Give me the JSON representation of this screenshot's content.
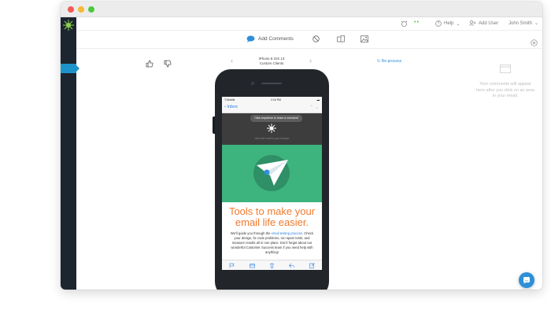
{
  "topbar": {
    "help_label": "Help",
    "add_user_label": "Add User",
    "user_name": "John Smith"
  },
  "toolbar": {
    "add_comments_label": "Add Comments"
  },
  "preview": {
    "device_line1": "iPhone 8 iOS 13",
    "device_line2": "Custom Clients",
    "reprocess_label": "Re-process"
  },
  "comments": {
    "empty_text": "Your comments will appear here after you click on an area in your email."
  },
  "email": {
    "carrier": "T-Mobile",
    "time": "2:16 PM",
    "back_label": "Inbox",
    "tooltip": "Click anywhere to leave a comment",
    "view_in_browser": "View this email in your browser",
    "headline": "Tools to make your email life easier.",
    "body_before_link": "We'll guide you through the ",
    "body_link": "email testing process",
    "body_after_link": ". Check your design, fix code problems, run spam tests, and measure results all in one place. Don't forget about our wonderful Customer Success team if you need help with anything!"
  },
  "colors": {
    "accent": "#2f8fd8",
    "headline": "#ef7a2d",
    "hero_green": "#3db47d",
    "sidebar": "#1d2530"
  }
}
